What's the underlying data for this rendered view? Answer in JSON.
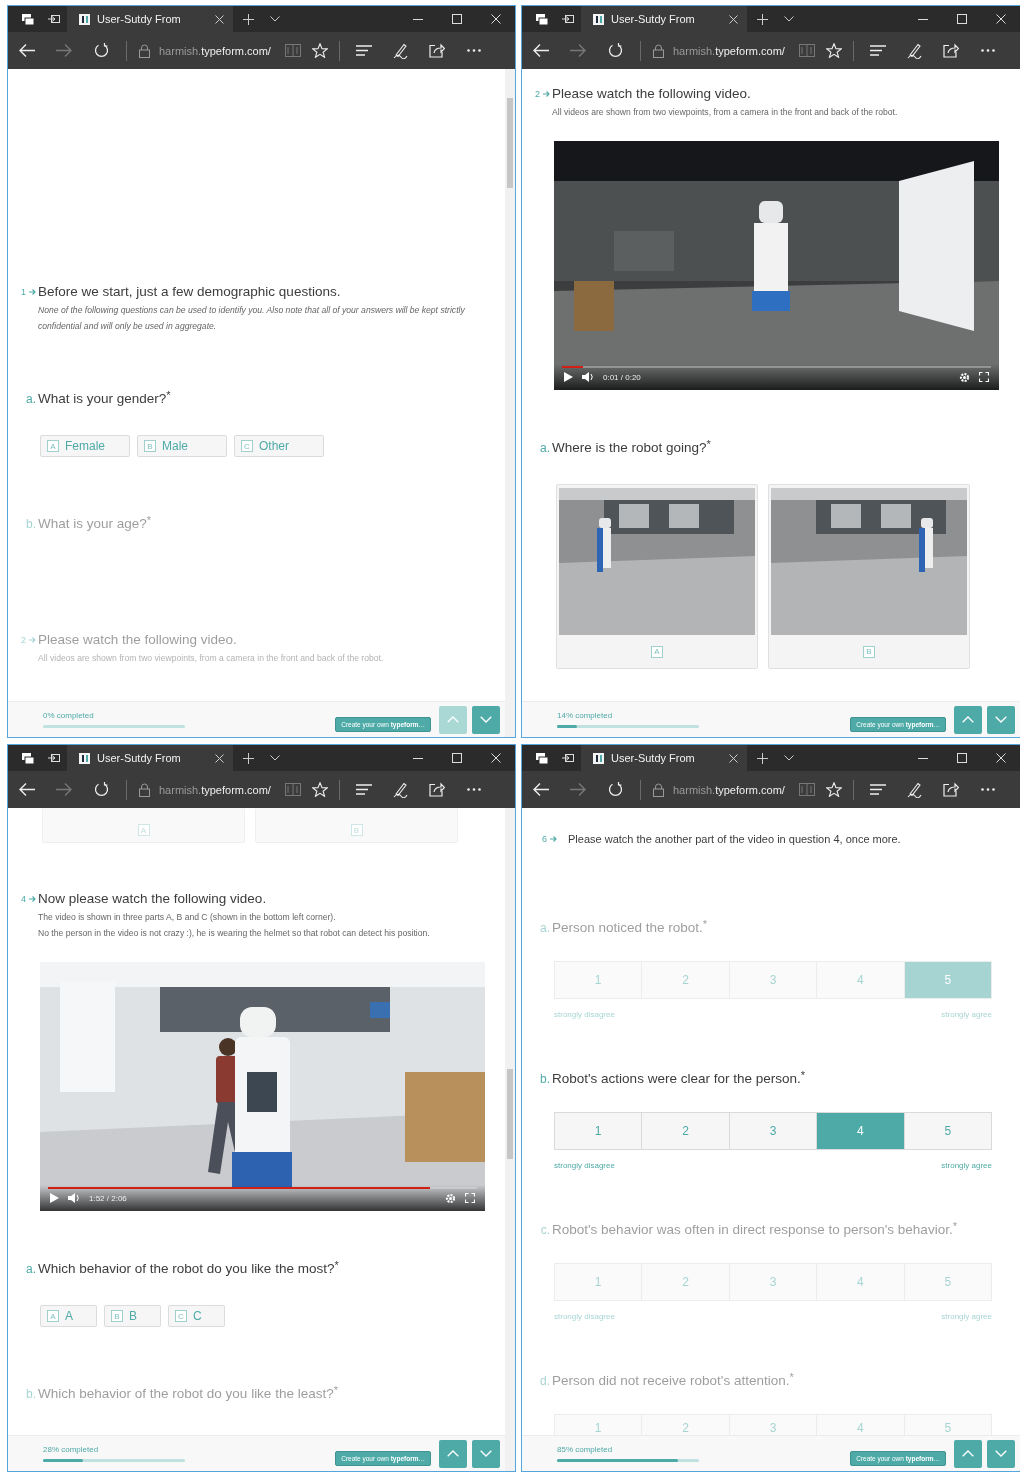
{
  "windows": [
    {
      "tab_title": "User-Sutdy From",
      "url_host": "harmish.",
      "url_domain": "typeform.com/",
      "blocks": [
        {
          "kind": "intro",
          "number": "1",
          "title": "Before we start, just a few demographic questions.",
          "description": [
            "None of the following questions can be used to identify you. Also note that all of your answers will be kept strictly confidential and will only be used in aggregate."
          ],
          "italic": true,
          "faded": false
        },
        {
          "kind": "question",
          "letter": "a.",
          "text": "What is your gender?",
          "required_mark": "*",
          "faded": false
        },
        {
          "kind": "choices",
          "faded": false,
          "options": [
            {
              "key": "A",
              "label": "Female",
              "selected": false
            },
            {
              "key": "B",
              "label": "Male",
              "selected": false
            },
            {
              "key": "C",
              "label": "Other",
              "selected": false
            }
          ]
        },
        {
          "kind": "question",
          "letter": "b.",
          "text": "What is your age?",
          "required_mark": "*",
          "faded": true
        },
        {
          "kind": "intro",
          "number": "2",
          "title": "Please watch the following video.",
          "description": [
            "All videos are shown from two viewpoints, from a camera in the front and back of the robot."
          ],
          "italic": false,
          "faded": true
        }
      ],
      "footer": {
        "progress_text": "0% completed",
        "level": 0,
        "promo": "Create your own **typeform**…",
        "up_button": {
          "disabled": true
        }
      }
    },
    {
      "tab_title": "User-Sutdy From",
      "url_host": "harmish.",
      "url_domain": "typeform.com/",
      "blocks": [
        {
          "kind": "intro",
          "number": "2",
          "title": "Please watch the following video.",
          "description": [
            "All videos are shown from two viewpoints, from a camera in the front and back of the robot."
          ],
          "italic": false,
          "faded": false
        },
        {
          "kind": "video",
          "time": "0:01 / 0:20",
          "level": 0.05
        },
        {
          "kind": "question",
          "letter": "a.",
          "text": "Where is the robot going?",
          "required_mark": "*",
          "faded": false
        },
        {
          "kind": "image_choices",
          "faded": false,
          "options": [
            {
              "key": "A",
              "selected": false
            },
            {
              "key": "B",
              "selected": false
            }
          ]
        }
      ],
      "footer": {
        "progress_text": "14% completed",
        "level": 0.14,
        "promo": "Create your own **typeform**…",
        "up_button": {
          "disabled": false
        }
      }
    },
    {
      "tab_title": "User-Sutdy From",
      "url_host": "harmish.",
      "url_domain": "typeform.com/",
      "blocks": [
        {
          "kind": "card_tails",
          "faded": true,
          "options": [
            {
              "key": "A",
              "selected": false
            },
            {
              "key": "B",
              "selected": false
            }
          ]
        },
        {
          "kind": "intro",
          "number": "4",
          "title": "Now please watch the following video.",
          "description": [
            "The video is shown in three parts A, B and C (shown in the bottom left corner).",
            "No the person in the video is not crazy :), he is wearing the helmet so that robot can detect his position."
          ],
          "italic": false,
          "faded": false
        },
        {
          "kind": "video",
          "time": "1:52 / 2:06",
          "level": 0.89
        },
        {
          "kind": "question",
          "letter": "a.",
          "text": "Which behavior of the robot do you like the most?",
          "required_mark": "*",
          "faded": false
        },
        {
          "kind": "choices",
          "faded": false,
          "options": [
            {
              "key": "A",
              "label": "A",
              "selected": false
            },
            {
              "key": "B",
              "label": "B",
              "selected": false
            },
            {
              "key": "C",
              "label": "C",
              "selected": false
            }
          ]
        },
        {
          "kind": "question",
          "letter": "b.",
          "text": "Which behavior of the robot do you like the least?",
          "required_mark": "*",
          "faded": true
        }
      ],
      "footer": {
        "progress_text": "28% completed",
        "level": 0.28,
        "promo": "Create your own **typeform**…",
        "up_button": {
          "disabled": false
        }
      }
    },
    {
      "tab_title": "User-Sutdy From",
      "url_host": "harmish.",
      "url_domain": "typeform.com/",
      "blocks": [
        {
          "kind": "note",
          "number": "6",
          "title": "Please watch the another part of the video in question 4, once more.",
          "faded": false
        },
        {
          "kind": "question",
          "letter": "a.",
          "text": "Person noticed the robot.",
          "required_mark": "*",
          "faded": true
        },
        {
          "kind": "rating",
          "faded": true,
          "options": [
            {
              "label": "1",
              "selected": false
            },
            {
              "label": "2",
              "selected": false
            },
            {
              "label": "3",
              "selected": false
            },
            {
              "label": "4",
              "selected": false
            },
            {
              "label": "5",
              "selected": true
            }
          ],
          "low_label": "strongly disagree",
          "high_label": "strongly agree"
        },
        {
          "kind": "question",
          "letter": "b.",
          "text": "Robot's actions were clear for the person.",
          "required_mark": "*",
          "faded": false
        },
        {
          "kind": "rating",
          "faded": false,
          "options": [
            {
              "label": "1",
              "selected": false
            },
            {
              "label": "2",
              "selected": false
            },
            {
              "label": "3",
              "selected": false
            },
            {
              "label": "4",
              "selected": true
            },
            {
              "label": "5",
              "selected": false
            }
          ],
          "low_label": "strongly disagree",
          "high_label": "strongly agree"
        },
        {
          "kind": "question",
          "letter": "c.",
          "text": "Robot's behavior was often in direct response to person's behavior.",
          "required_mark": "*",
          "faded": true
        },
        {
          "kind": "rating",
          "faded": true,
          "options": [
            {
              "label": "1",
              "selected": false
            },
            {
              "label": "2",
              "selected": false
            },
            {
              "label": "3",
              "selected": false
            },
            {
              "label": "4",
              "selected": false
            },
            {
              "label": "5",
              "selected": false
            }
          ],
          "low_label": "strongly disagree",
          "high_label": "strongly agree"
        },
        {
          "kind": "question",
          "letter": "d.",
          "text": "Person did not receive robot's attention.",
          "required_mark": "*",
          "faded": true
        },
        {
          "kind": "rating_top",
          "faded": true,
          "options": [
            {
              "label": "1",
              "selected": false
            },
            {
              "label": "2",
              "selected": false
            },
            {
              "label": "3",
              "selected": false
            },
            {
              "label": "4",
              "selected": false
            },
            {
              "label": "5",
              "selected": false
            }
          ]
        }
      ],
      "footer": {
        "progress_text": "85% completed",
        "level": 0.85,
        "promo": "Create your own **typeform**…",
        "up_button": {
          "disabled": false
        }
      }
    }
  ]
}
